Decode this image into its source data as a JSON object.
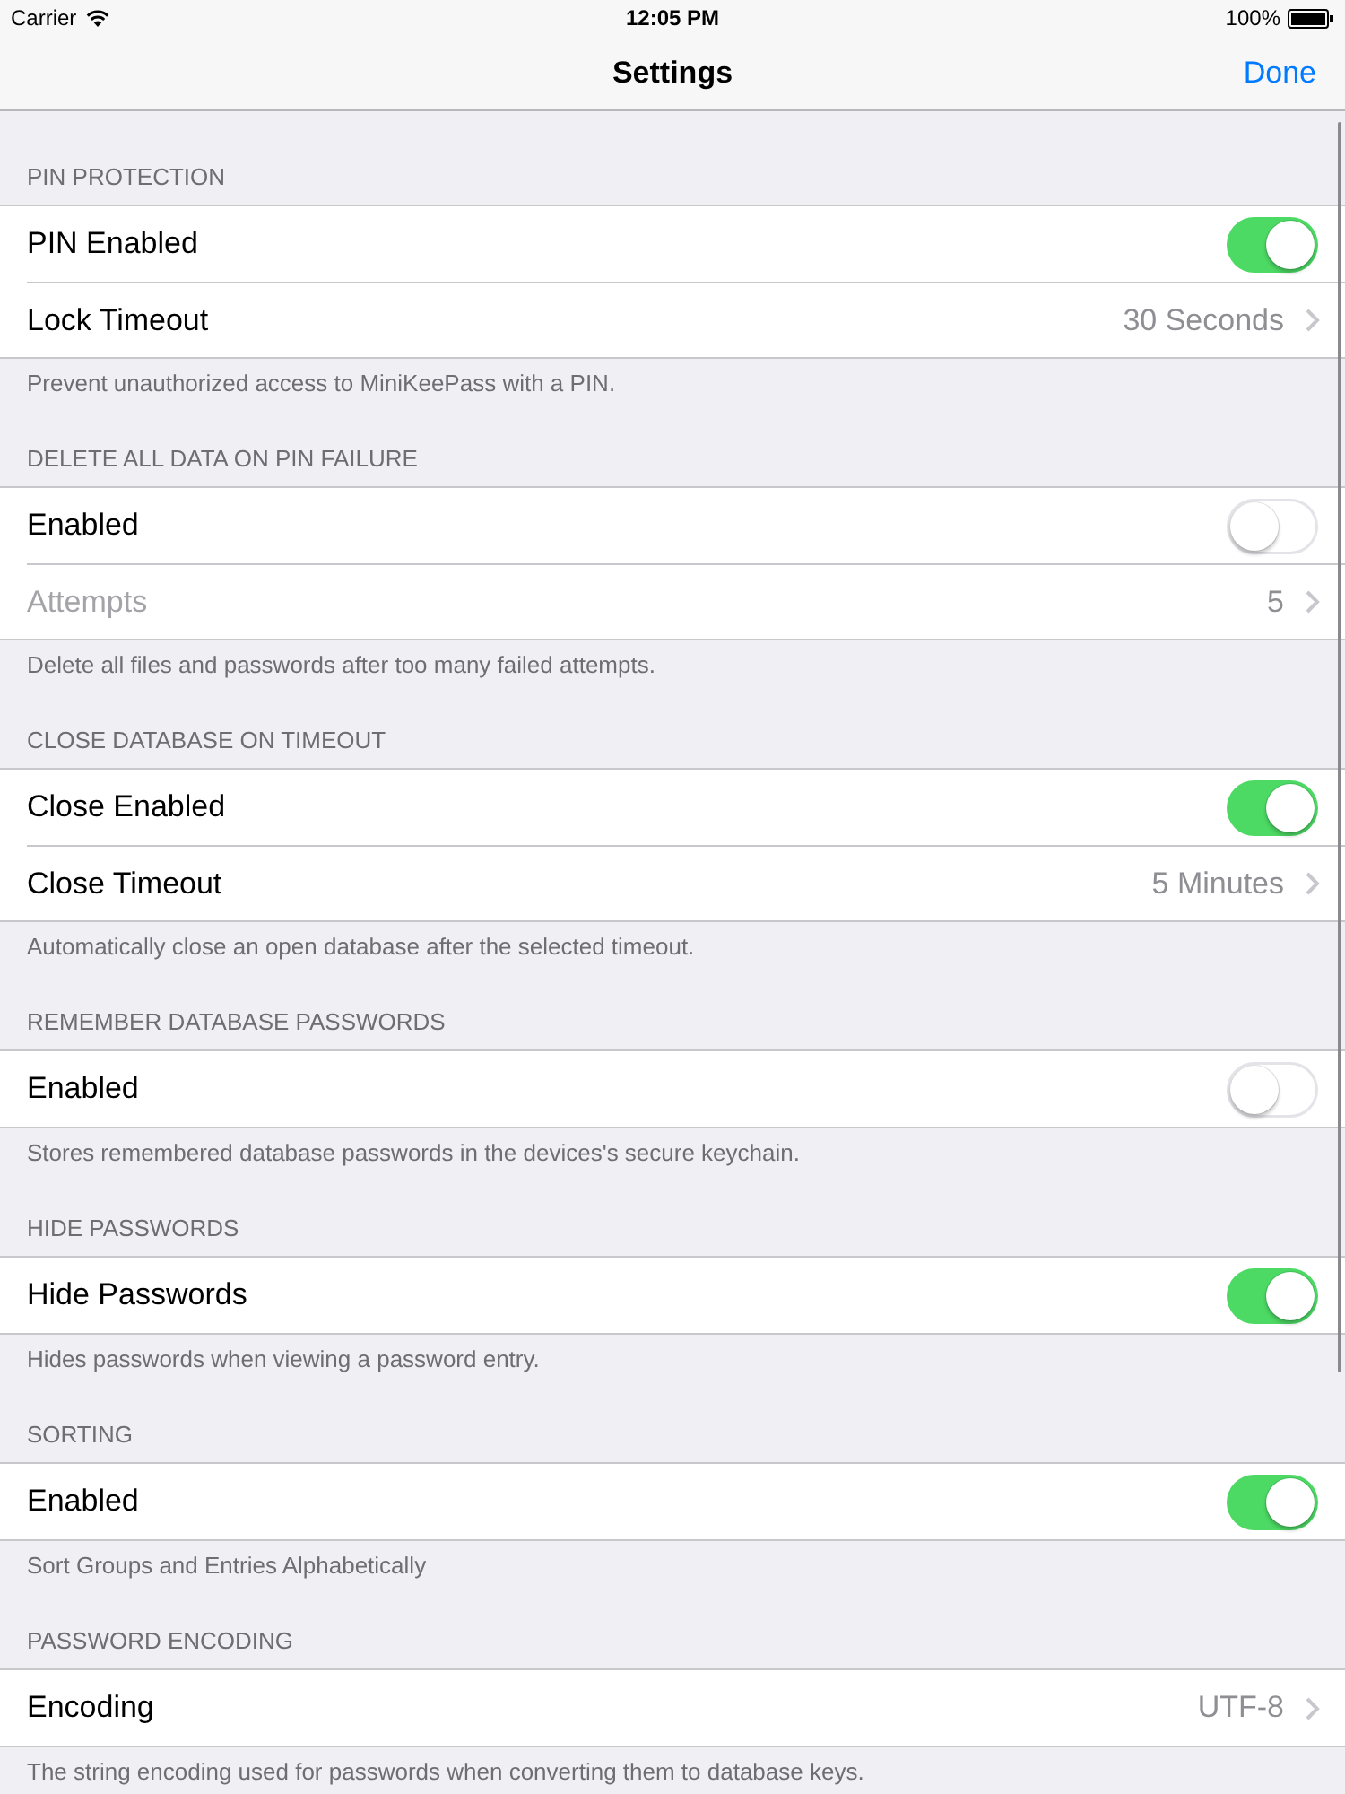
{
  "status_bar": {
    "carrier": "Carrier",
    "time": "12:05 PM",
    "battery": "100%"
  },
  "nav_bar": {
    "title": "Settings",
    "done_button": "Done"
  },
  "sections": [
    {
      "header": "PIN PROTECTION",
      "rows": [
        {
          "kind": "toggle",
          "label": "PIN Enabled",
          "on": true,
          "disabled": false
        },
        {
          "kind": "disclosure",
          "label": "Lock Timeout",
          "value": "30 Seconds",
          "disabled": false
        }
      ],
      "footer": "Prevent unauthorized access to MiniKeePass with a PIN."
    },
    {
      "header": "DELETE ALL DATA ON PIN FAILURE",
      "rows": [
        {
          "kind": "toggle",
          "label": "Enabled",
          "on": false,
          "disabled": false
        },
        {
          "kind": "disclosure",
          "label": "Attempts",
          "value": "5",
          "disabled": true
        }
      ],
      "footer": "Delete all files and passwords after too many failed attempts."
    },
    {
      "header": "CLOSE DATABASE ON TIMEOUT",
      "rows": [
        {
          "kind": "toggle",
          "label": "Close Enabled",
          "on": true,
          "disabled": false
        },
        {
          "kind": "disclosure",
          "label": "Close Timeout",
          "value": "5 Minutes",
          "disabled": false
        }
      ],
      "footer": "Automatically close an open database after the selected timeout."
    },
    {
      "header": "REMEMBER DATABASE PASSWORDS",
      "rows": [
        {
          "kind": "toggle",
          "label": "Enabled",
          "on": false,
          "disabled": false
        }
      ],
      "footer": "Stores remembered database passwords in the devices's secure keychain."
    },
    {
      "header": "HIDE PASSWORDS",
      "rows": [
        {
          "kind": "toggle",
          "label": "Hide Passwords",
          "on": true,
          "disabled": false
        }
      ],
      "footer": "Hides passwords when viewing a password entry."
    },
    {
      "header": "SORTING",
      "rows": [
        {
          "kind": "toggle",
          "label": "Enabled",
          "on": true,
          "disabled": false
        }
      ],
      "footer": "Sort Groups and Entries Alphabetically"
    },
    {
      "header": "PASSWORD ENCODING",
      "rows": [
        {
          "kind": "disclosure",
          "label": "Encoding",
          "value": "UTF-8",
          "disabled": false
        }
      ],
      "footer": "The string encoding used for passwords when converting them to database keys."
    }
  ]
}
